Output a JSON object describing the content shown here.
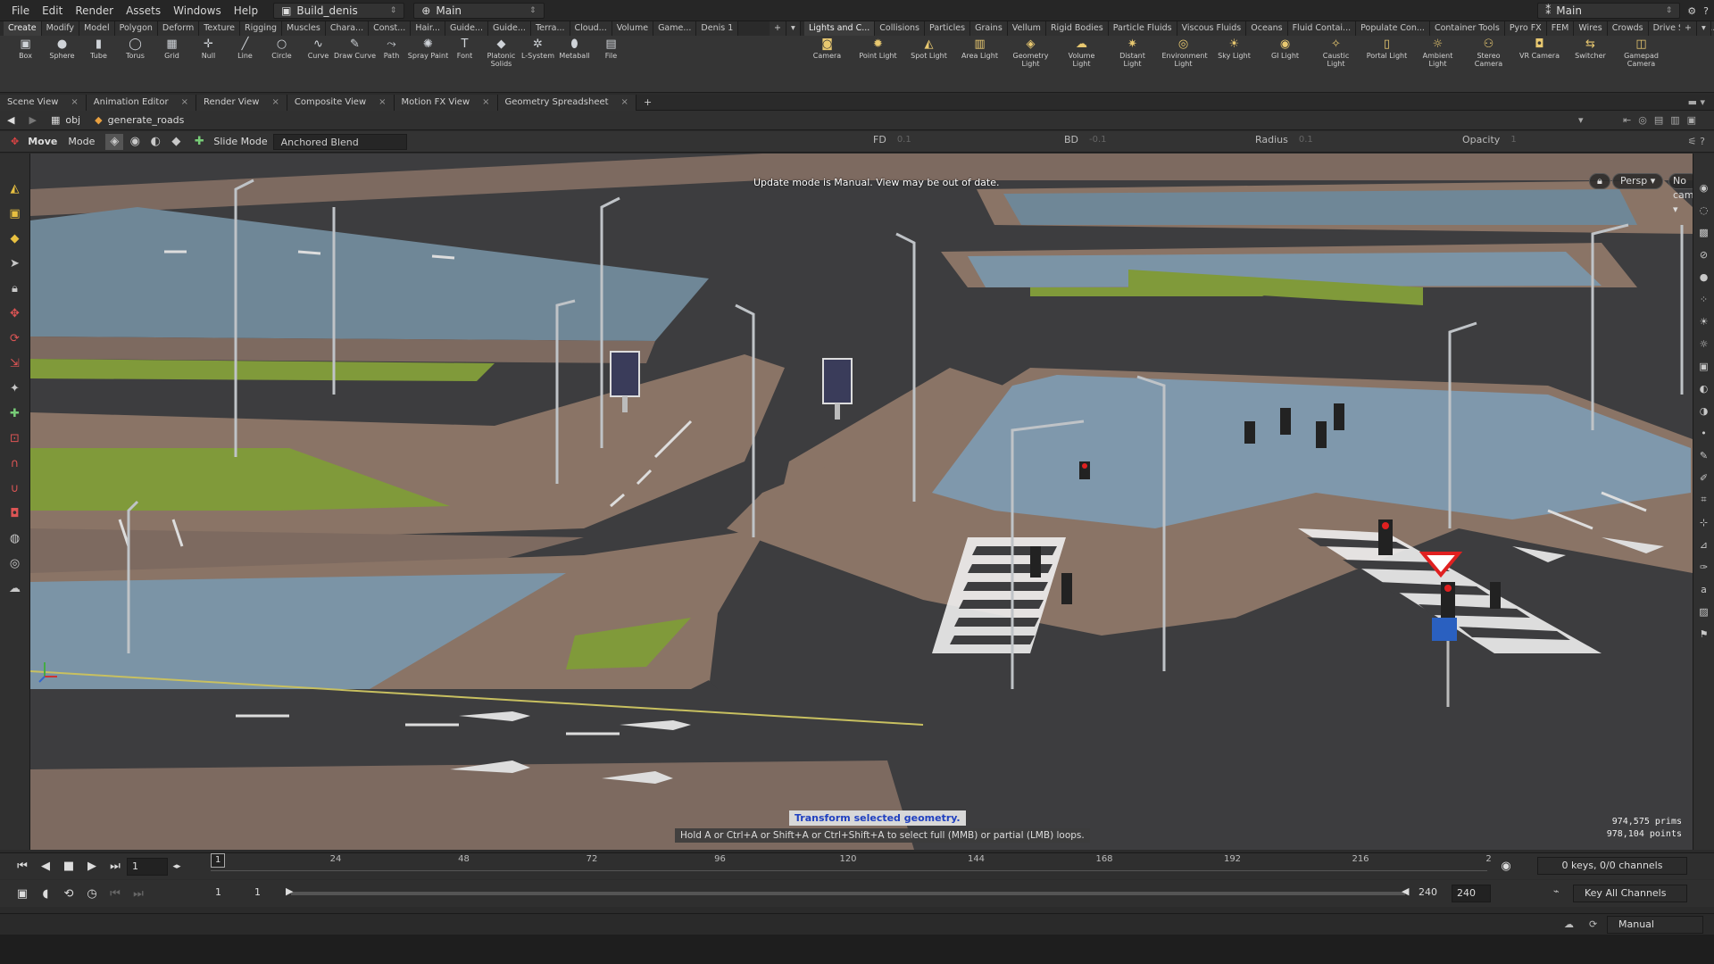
{
  "menu": [
    "File",
    "Edit",
    "Render",
    "Assets",
    "Windows",
    "Help"
  ],
  "desktop": {
    "name": "Build_denis",
    "context": "Main"
  },
  "top_right": {
    "desktop": "Main"
  },
  "shelf_left_tabs": [
    "Create",
    "Modify",
    "Model",
    "Polygon",
    "Deform",
    "Texture",
    "Rigging",
    "Muscles",
    "Chara...",
    "Const...",
    "Hair...",
    "Guide...",
    "Guide...",
    "Terra...",
    "Cloud...",
    "Volume",
    "Game...",
    "Denis 1"
  ],
  "shelf_right_tabs": [
    "Lights and C...",
    "Collisions",
    "Particles",
    "Grains",
    "Vellum",
    "Rigid Bodies",
    "Particle Fluids",
    "Viscous Fluids",
    "Oceans",
    "Fluid Contai...",
    "Populate Con...",
    "Container Tools",
    "Pyro FX",
    "FEM",
    "Wires",
    "Crowds",
    "Drive Simula..."
  ],
  "left_tools": [
    {
      "label": "Box",
      "icon": "box-icon"
    },
    {
      "label": "Sphere",
      "icon": "sphere-icon"
    },
    {
      "label": "Tube",
      "icon": "tube-icon"
    },
    {
      "label": "Torus",
      "icon": "torus-icon"
    },
    {
      "label": "Grid",
      "icon": "grid-icon"
    },
    {
      "label": "Null",
      "icon": "null-icon"
    },
    {
      "label": "Line",
      "icon": "line-icon"
    },
    {
      "label": "Circle",
      "icon": "circle-icon"
    },
    {
      "label": "Curve",
      "icon": "curve-icon"
    },
    {
      "label": "Draw Curve",
      "icon": "draw-curve-icon"
    },
    {
      "label": "Path",
      "icon": "path-icon"
    },
    {
      "label": "Spray Paint",
      "icon": "spray-paint-icon"
    },
    {
      "label": "Font",
      "icon": "font-icon"
    },
    {
      "label": "Platonic Solids",
      "icon": "platonic-icon"
    },
    {
      "label": "L-System",
      "icon": "lsystem-icon"
    },
    {
      "label": "Metaball",
      "icon": "metaball-icon"
    },
    {
      "label": "File",
      "icon": "file-icon"
    }
  ],
  "right_tools": [
    {
      "label": "Camera",
      "icon": "camera-icon"
    },
    {
      "label": "Point Light",
      "icon": "point-light-icon"
    },
    {
      "label": "Spot Light",
      "icon": "spot-light-icon"
    },
    {
      "label": "Area Light",
      "icon": "area-light-icon"
    },
    {
      "label": "Geometry Light",
      "icon": "geometry-light-icon"
    },
    {
      "label": "Volume Light",
      "icon": "volume-light-icon"
    },
    {
      "label": "Distant Light",
      "icon": "distant-light-icon"
    },
    {
      "label": "Environment Light",
      "icon": "environment-light-icon"
    },
    {
      "label": "Sky Light",
      "icon": "sky-light-icon"
    },
    {
      "label": "GI Light",
      "icon": "gi-light-icon"
    },
    {
      "label": "Caustic Light",
      "icon": "caustic-light-icon"
    },
    {
      "label": "Portal Light",
      "icon": "portal-light-icon"
    },
    {
      "label": "Ambient Light",
      "icon": "ambient-light-icon"
    },
    {
      "label": "Stereo Camera",
      "icon": "stereo-camera-icon"
    },
    {
      "label": "VR Camera",
      "icon": "vr-camera-icon"
    },
    {
      "label": "Switcher",
      "icon": "switcher-icon"
    },
    {
      "label": "Gamepad Camera",
      "icon": "gamepad-camera-icon"
    }
  ],
  "pane_tabs": [
    "Scene View",
    "Animation Editor",
    "Render View",
    "Composite View",
    "Motion FX View",
    "Geometry Spreadsheet"
  ],
  "path": {
    "root": "obj",
    "node": "generate_roads"
  },
  "tool_options": {
    "tool": "Move",
    "mode": "Mode",
    "slide_mode_label": "Slide Mode",
    "slide_mode_value": "Anchored Blend",
    "fd_label": "FD",
    "fd_value": "0.1",
    "bd_label": "BD",
    "bd_value": "-0.1",
    "radius_label": "Radius",
    "radius_value": "0.1",
    "opacity_label": "Opacity",
    "opacity_value": "1"
  },
  "viewport": {
    "update_message": "Update mode is Manual. View may be out of date.",
    "persp": "Persp",
    "cam": "No cam",
    "hint_title": "Transform selected geometry.",
    "hint_body": "Hold A or Ctrl+A or Shift+A or Ctrl+Shift+A to select full (MMB) or partial (LMB) loops.",
    "prims": "974,575  prims",
    "points": "978,104  points"
  },
  "timeline": {
    "current_frame": "1",
    "marker": "1",
    "ticks": [
      "24",
      "48",
      "72",
      "96",
      "120",
      "144",
      "168",
      "192",
      "216",
      "2"
    ],
    "range_start": "1",
    "range_start2": "1",
    "range_end": "240",
    "range_end2": "240",
    "channels": "0 keys, 0/0 channels",
    "key_all": "Key All Channels",
    "update_mode": "Manual"
  },
  "colors": {
    "road": "#3a3a3c",
    "water": "#7f98ac",
    "pavement": "#8a7466",
    "grass": "#8aa23a",
    "accent": "#e0e0e0"
  }
}
